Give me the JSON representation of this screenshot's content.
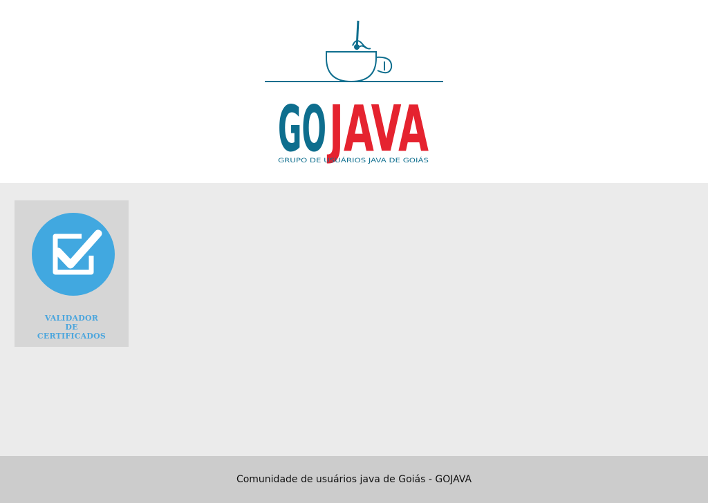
{
  "header": {
    "logo": {
      "word_part1": "GO",
      "word_part2": "JAVA",
      "tagline": "GRUPO DE USUÁRIOS JAVA DE GOIÁS",
      "colors": {
        "primary_blue": "#0e6e8e",
        "accent_red": "#e5232f",
        "line": "#0e6e8e"
      },
      "icon": "coffee-cup-icon"
    }
  },
  "main": {
    "validator": {
      "icon": "checkbox-check-icon",
      "line1": "VALIDADOR",
      "line2": "DE",
      "line3": "CERTIFICADOS",
      "icon_color": "#41a8e0",
      "text_color": "#4da6dd"
    }
  },
  "footer": {
    "text": "Comunidade de usuários java de Goiás - GOJAVA"
  }
}
